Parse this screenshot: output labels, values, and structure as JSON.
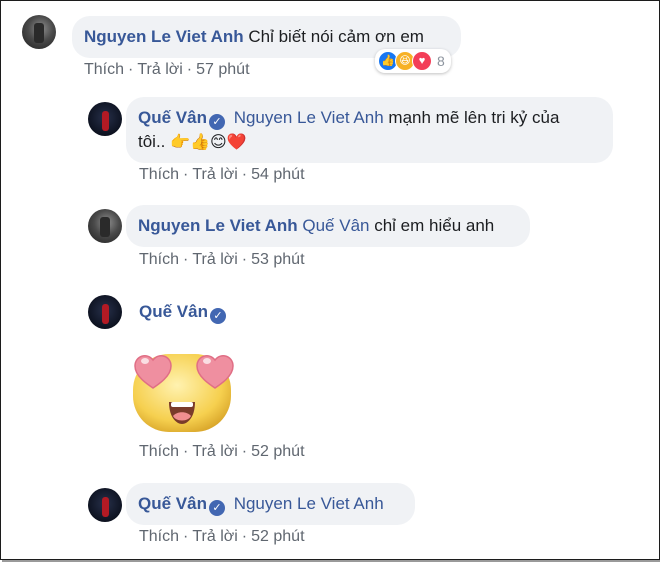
{
  "comments": [
    {
      "author": "Nguyen Le Viet Anh",
      "text": "Chỉ biết nói cảm ơn em",
      "actions": {
        "like": "Thích",
        "reply": "Trả lời",
        "time": "57 phút"
      },
      "reactions": {
        "icons": [
          "like-icon",
          "haha-icon",
          "love-icon"
        ],
        "count": "8"
      }
    },
    {
      "author": "Quế Vân",
      "verified": true,
      "mention": "Nguyen Le Viet Anh",
      "text_line1": "mạnh mẽ lên tri kỷ của",
      "text_line2": "tôi..",
      "emojis": "👉👍😊❤️",
      "actions": {
        "like": "Thích",
        "reply": "Trả lời",
        "time": "54 phút"
      }
    },
    {
      "author": "Nguyen Le Viet Anh",
      "mention": "Quế Vân",
      "text": "chỉ em hiểu anh",
      "actions": {
        "like": "Thích",
        "reply": "Trả lời",
        "time": "53 phút"
      }
    },
    {
      "author": "Quế Vân",
      "verified": true,
      "sticker": "heart-eyes-sticker",
      "actions": {
        "like": "Thích",
        "reply": "Trả lời",
        "time": "52 phút"
      }
    },
    {
      "author": "Quế Vân",
      "verified": true,
      "mention": "Nguyen Le Viet Anh",
      "actions": {
        "like": "Thích",
        "reply": "Trả lời",
        "time": "52 phút"
      }
    }
  ],
  "colors": {
    "name": "#385898",
    "bubble": "#f0f2f5",
    "meta": "#606770",
    "verified": "#4267b2"
  }
}
